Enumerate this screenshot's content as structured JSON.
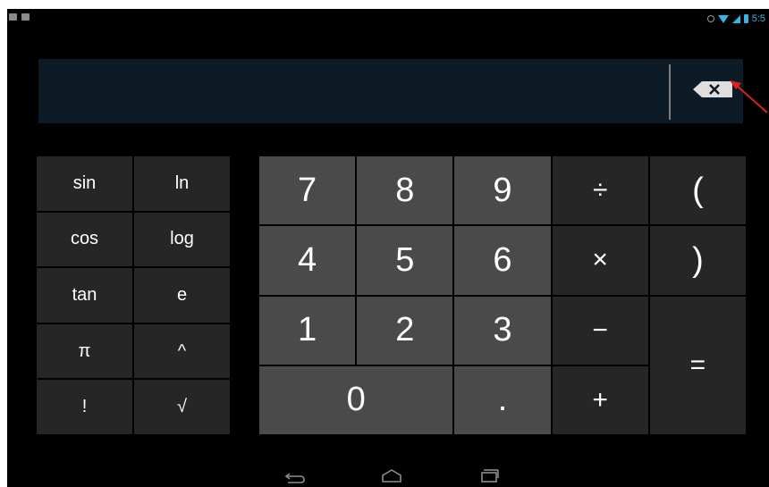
{
  "status_bar": {
    "left_icons": [
      "picture-icon",
      "mail-icon"
    ],
    "right_icons": [
      "sync-icon",
      "wifi-icon",
      "signal-icon",
      "battery-icon"
    ],
    "time": "5:5"
  },
  "display": {
    "expression": "",
    "delete_icon": "backspace-icon"
  },
  "advanced_pad": {
    "keys": [
      "sin",
      "ln",
      "cos",
      "log",
      "tan",
      "e",
      "π",
      "^",
      "!",
      "√"
    ]
  },
  "main_pad": {
    "keys": {
      "seven": "7",
      "eight": "8",
      "nine": "9",
      "divide": "÷",
      "lparen": "(",
      "four": "4",
      "five": "5",
      "six": "6",
      "multiply": "×",
      "rparen": ")",
      "one": "1",
      "two": "2",
      "three": "3",
      "minus": "−",
      "equals": "=",
      "zero": "0",
      "dot": ".",
      "plus": "+"
    }
  },
  "annotation": {
    "arrow_color": "#e02020"
  },
  "colors": {
    "background": "#000000",
    "display_bg": "#0c1b26",
    "digit_key": "#4a4a4a",
    "operator_key": "#262626",
    "status_accent": "#33b5e5"
  },
  "nav_bar": {
    "buttons": [
      "back-icon",
      "home-icon",
      "recent-apps-icon"
    ]
  }
}
